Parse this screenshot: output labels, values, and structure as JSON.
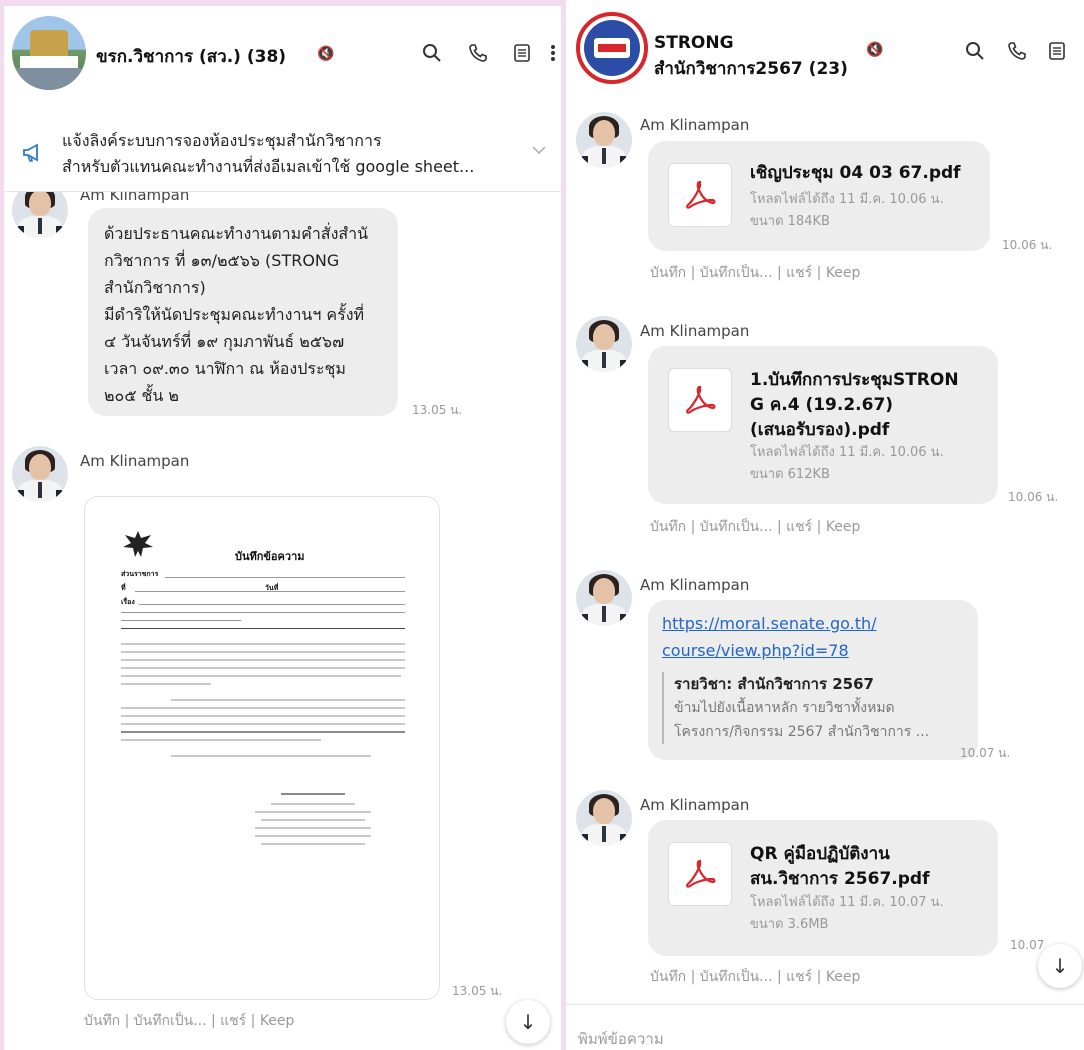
{
  "left": {
    "group_name": "ขรก.วิชาการ (สว.) (38)",
    "announcement": {
      "line1": "แจ้งลิงค์ระบบการจองห้องประชุมสำนักวิชาการ",
      "line2": "สำหรับตัวแทนคณะทำงานที่ส่งอีเมลเข้าใช้ google sheet..."
    },
    "partial_sender": "Am Klinampan",
    "message1": {
      "lines": [
        "ด้วยประธานคณะทำงานตามคำสั่งสำนั",
        "กวิชาการ ที่ ๑๓/๒๕๖๖ (STRONG",
        "สำนักวิชาการ)",
        "มีดำริให้นัดประชุมคณะทำงานฯ ครั้งที่",
        "๔ วันจันทร์ที่ ๑๙ กุมภาพันธ์ ๒๕๖๗",
        "เวลา ๐๙.๓๐ นาฬิกา ณ ห้องประชุม",
        "๒๐๕ ชั้น ๒"
      ],
      "time": "13.05 น."
    },
    "message2": {
      "sender": "Am Klinampan",
      "doc_title": "บันทึกข้อความ",
      "doc_fields": {
        "agency": "ส่วนราชการ",
        "number": "ที่",
        "date": "วันที่",
        "subject": "เรื่อง"
      },
      "time": "13.05 น.",
      "actions": "บันทึก | บันทึกเป็น... | แชร์ | Keep"
    },
    "scroll_icon": "↓"
  },
  "right": {
    "group_name_line1": "STRONG",
    "group_name_line2": "สำนักวิชาการ2567 (23)",
    "messages": [
      {
        "sender": "Am Klinampan",
        "file_name_lines": [
          "เชิญประชุม 04 03 67.pdf"
        ],
        "meta1": "โหลดไฟล์ได้ถึง 11 มี.ค. 10.06 น.",
        "meta2": "ขนาด 184KB",
        "time": "10.06 น.",
        "actions": "บันทึก | บันทึกเป็น... | แชร์ | Keep"
      },
      {
        "sender": "Am Klinampan",
        "file_name_lines": [
          "1.บันทึกการประชุมSTRON",
          "G ค.4 (19.2.67)",
          "(เสนอรับรอง).pdf"
        ],
        "meta1": "โหลดไฟล์ได้ถึง 11 มี.ค. 10.06 น.",
        "meta2": "ขนาด 612KB",
        "time": "10.06 น.",
        "actions": "บันทึก | บันทึกเป็น... | แชร์ | Keep"
      },
      {
        "sender": "Am Klinampan",
        "link_line1": "https://moral.senate.go.th/",
        "link_line2": "course/view.php?id=78",
        "preview_title": "รายวิชา: สำนักวิชาการ 2567",
        "preview_line1": "ข้ามไปยังเนื้อหาหลัก รายวิชาทั้งหมด",
        "preview_line2": "โครงการ/กิจกรรม 2567 สำนักวิชาการ ...",
        "time": "10.07 น."
      },
      {
        "sender": "Am Klinampan",
        "file_name_lines": [
          "QR คู่มือปฏิบัติงาน",
          "สน.วิชาการ 2567.pdf"
        ],
        "meta1": "โหลดไฟล์ได้ถึง 11 มี.ค. 10.07 น.",
        "meta2": "ขนาด 3.6MB",
        "time": "10.07",
        "actions": "บันทึก | บันทึกเป็น... | แชร์ | Keep"
      }
    ],
    "input_placeholder": "พิมพ์ข้อความ",
    "scroll_icon": "↓"
  },
  "colors": {
    "background": "#f3dcef",
    "pdf_red": "#d9252b",
    "link": "#2266cc"
  }
}
